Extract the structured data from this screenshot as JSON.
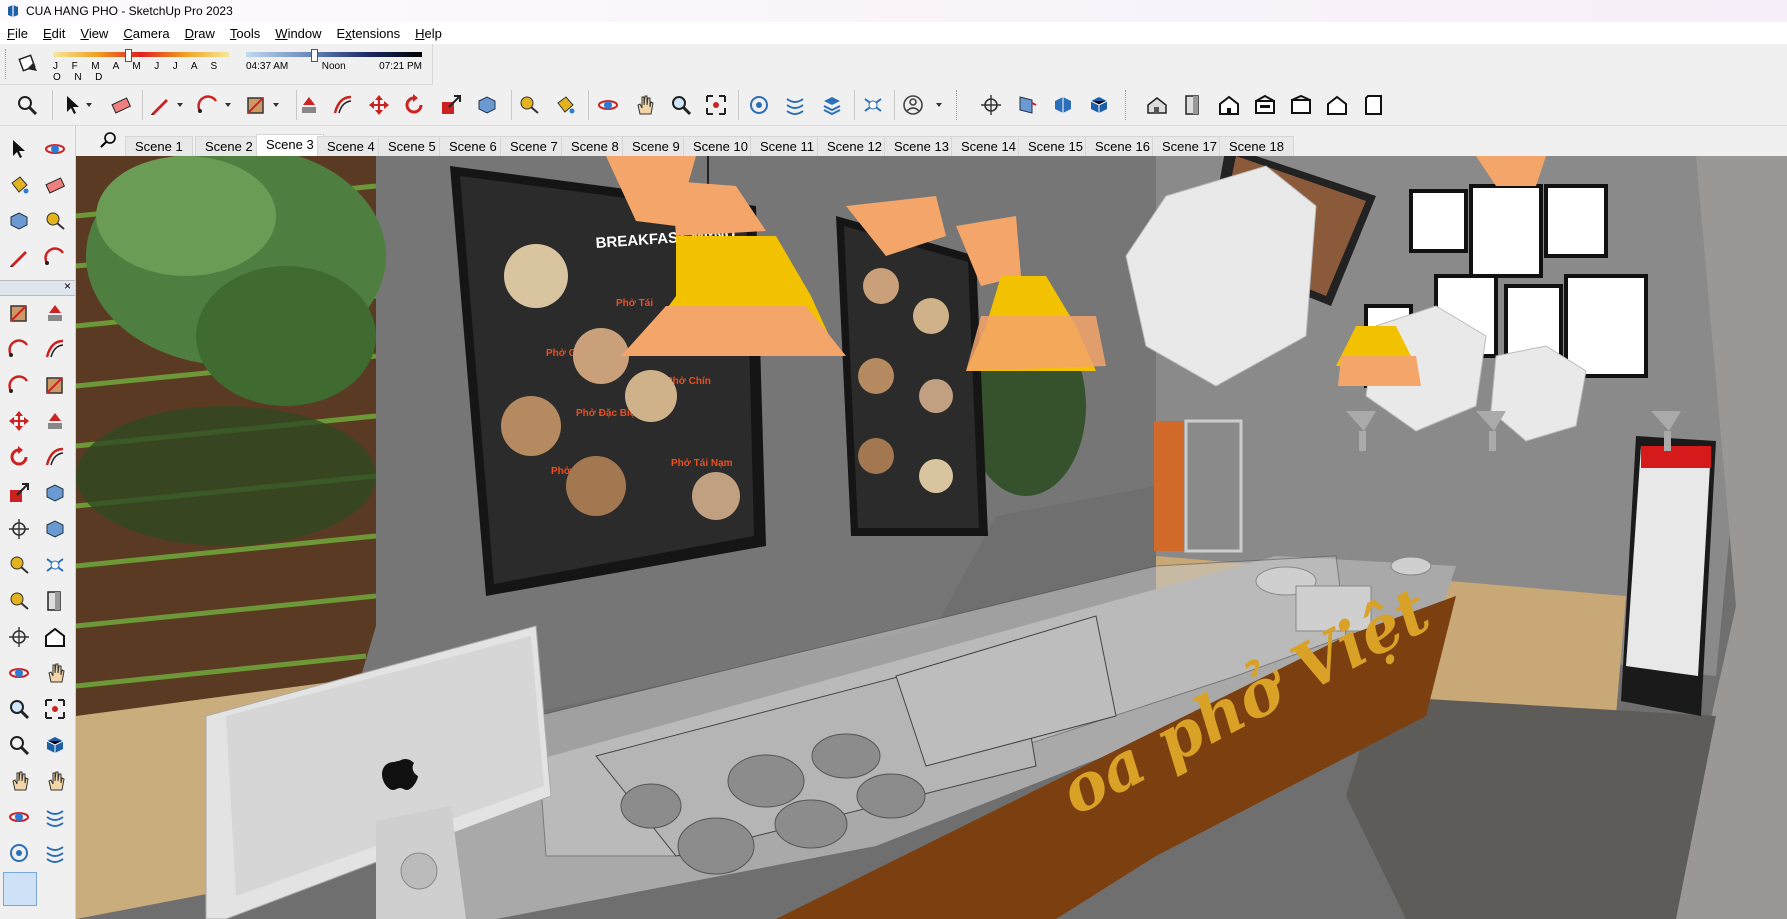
{
  "window": {
    "title": "CUA HANG PHO - SketchUp Pro 2023"
  },
  "menu": [
    {
      "label": "File",
      "key": "F"
    },
    {
      "label": "Edit",
      "key": "E"
    },
    {
      "label": "View",
      "key": "V"
    },
    {
      "label": "Camera",
      "key": "C"
    },
    {
      "label": "Draw",
      "key": "D"
    },
    {
      "label": "Tools",
      "key": "T"
    },
    {
      "label": "Window",
      "key": "W"
    },
    {
      "label": "Extensions",
      "key": "x"
    },
    {
      "label": "Help",
      "key": "H"
    }
  ],
  "shadows": {
    "months": "J F M A M J J A S O N D",
    "sunrise": "04:37 AM",
    "noon": "Noon",
    "sunset": "07:21 PM"
  },
  "scenes": [
    "Scene 1",
    "Scene 2",
    "Scene 3",
    "Scene 4",
    "Scene 5",
    "Scene 6",
    "Scene 7",
    "Scene 8",
    "Scene 9",
    "Scene 10",
    "Scene 11",
    "Scene 12",
    "Scene 13",
    "Scene 14",
    "Scene 15",
    "Scene 16",
    "Scene 17",
    "Scene 18"
  ],
  "active_scene": "Scene 3",
  "scene_content": {
    "menu_board_title": "BREAKFAST MENU",
    "menu_items_left": [
      "Phở Tái",
      "Phở Gầu",
      "Phở Chín",
      "Phở Đặc Biệt",
      "Phở Đập Bò",
      "Phở Tái Nạm"
    ],
    "counter_sign": "oa phở Việt"
  },
  "colors": {
    "accent": "#f2c200",
    "lamp_orange": "#f4a56a",
    "wood": "#7a4a1e",
    "counter_front": "#7b3f10",
    "sign_gold": "#d9a227"
  }
}
